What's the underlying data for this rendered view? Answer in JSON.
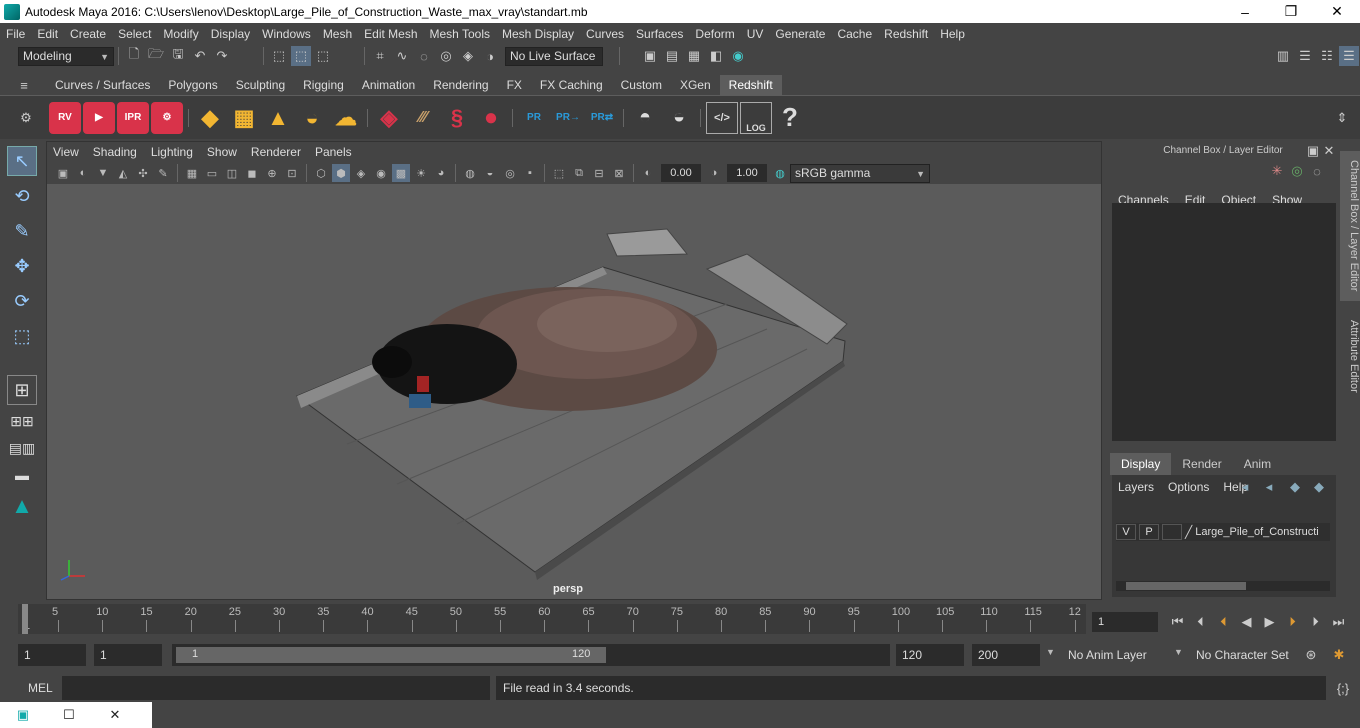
{
  "window": {
    "title": "Autodesk Maya 2016: C:\\Users\\lenov\\Desktop\\Large_Pile_of_Construction_Waste_max_vray\\standart.mb",
    "minimize": "–",
    "maximize": "❐",
    "close": "✕"
  },
  "menubar": [
    "File",
    "Edit",
    "Create",
    "Select",
    "Modify",
    "Display",
    "Windows",
    "Mesh",
    "Edit Mesh",
    "Mesh Tools",
    "Mesh Display",
    "Curves",
    "Surfaces",
    "Deform",
    "UV",
    "Generate",
    "Cache",
    "Redshift",
    "Help"
  ],
  "statusline": {
    "mode": "Modeling",
    "live_surface": "No Live Surface"
  },
  "shelf_tabs": [
    "Curves / Surfaces",
    "Polygons",
    "Sculpting",
    "Rigging",
    "Animation",
    "Rendering",
    "FX",
    "FX Caching",
    "Custom",
    "XGen",
    "Redshift"
  ],
  "shelf_active": "Redshift",
  "shelf_icons": {
    "rv": "RV",
    "ipr": "IPR",
    "pr": "PR",
    "log": "LOG",
    "help": "?"
  },
  "panel": {
    "menu": [
      "View",
      "Shading",
      "Lighting",
      "Show",
      "Renderer",
      "Panels"
    ],
    "exposure": "0.00",
    "gamma": "1.00",
    "colorspace": "sRGB gamma",
    "camera": "persp"
  },
  "channelbox": {
    "title": "Channel Box / Layer Editor",
    "menu": [
      "Channels",
      "Edit",
      "Object",
      "Show"
    ],
    "tabs": [
      "Display",
      "Render",
      "Anim"
    ],
    "layer_menu": [
      "Layers",
      "Options",
      "Help"
    ],
    "layer": {
      "v": "V",
      "p": "P",
      "name": "Large_Pile_of_Constructi"
    },
    "side_tab_1": "Channel Box / Layer Editor",
    "side_tab_2": "Attribute Editor"
  },
  "timeline": {
    "ticks": [
      "5",
      "10",
      "15",
      "20",
      "25",
      "30",
      "35",
      "40",
      "45",
      "50",
      "55",
      "60",
      "65",
      "70",
      "75",
      "80",
      "85",
      "90",
      "95",
      "100",
      "105",
      "110",
      "115",
      "12"
    ],
    "start_marker": "1",
    "current_frame": "1"
  },
  "range": {
    "start": "1",
    "playback_start": "1",
    "slider_start": "1",
    "slider_end": "120",
    "playback_end": "120",
    "end": "200",
    "anim_layer": "No Anim Layer",
    "character_set": "No Character Set"
  },
  "cmdline": {
    "label": "MEL",
    "feedback": "File read in  3.4 seconds."
  },
  "colors": {
    "accent": "#5d5d5d",
    "redshift_red": "#d9334a",
    "pr_blue": "#2a9ad9"
  }
}
